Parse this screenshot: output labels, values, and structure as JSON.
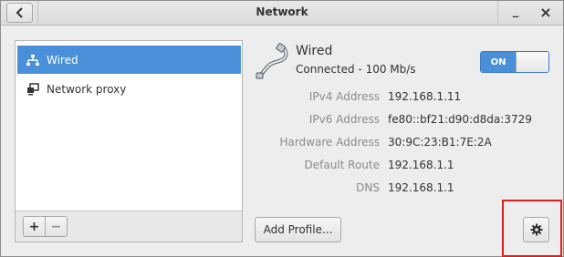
{
  "window": {
    "title": "Network"
  },
  "header": {
    "back_icon": "chevron-left-icon",
    "minimize_label": "_",
    "close_label": "×"
  },
  "sidebar": {
    "items": [
      {
        "label": "Wired",
        "icon": "wired-network-icon",
        "selected": true
      },
      {
        "label": "Network proxy",
        "icon": "network-proxy-icon",
        "selected": false
      }
    ],
    "add_label": "+",
    "remove_label": "−"
  },
  "device": {
    "name": "Wired",
    "status": "Connected - 100 Mb/s",
    "toggle_label": "ON",
    "toggle_state": "on",
    "details": [
      {
        "label": "IPv4 Address",
        "value": "192.168.1.11"
      },
      {
        "label": "IPv6 Address",
        "value": "fe80::bf21:d90:d8da:3729"
      },
      {
        "label": "Hardware Address",
        "value": "30:9C:23:B1:7E:2A"
      },
      {
        "label": "Default Route",
        "value": "192.168.1.1"
      },
      {
        "label": "DNS",
        "value": "192.168.1.1"
      }
    ]
  },
  "actions": {
    "add_profile_label": "Add Profile...",
    "settings_icon": "gear-icon"
  },
  "colors": {
    "accent": "#4a90d9",
    "highlight": "#e0201c"
  }
}
